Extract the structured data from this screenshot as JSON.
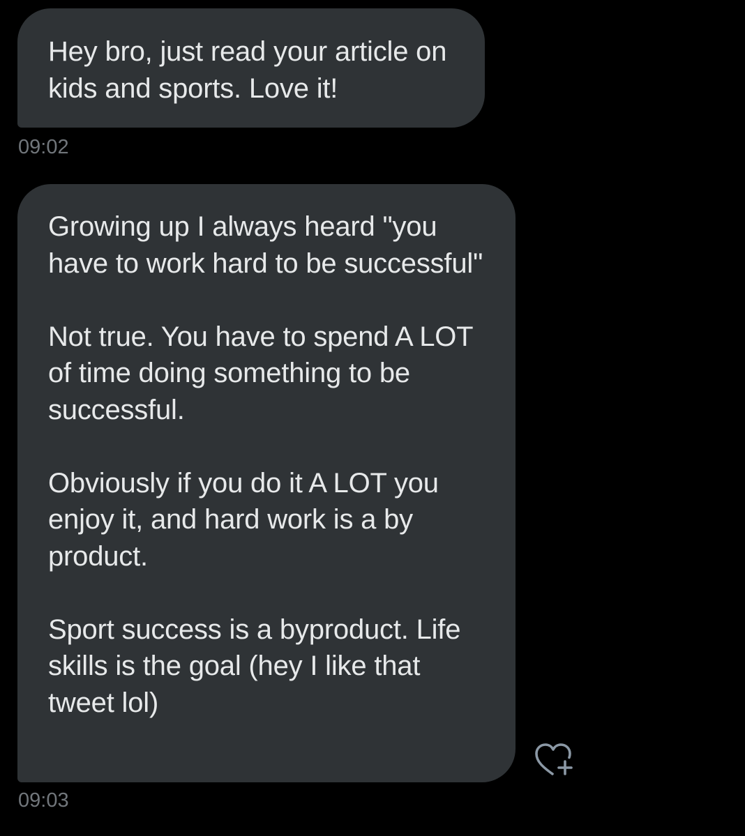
{
  "messages": [
    {
      "paragraphs": [
        "Hey bro, just read your article on kids and sports. Love it!"
      ],
      "time": "09:02"
    },
    {
      "paragraphs": [
        "Growing up I always heard \"you have to work hard to be successful\"",
        "Not true. You have to spend A LOT of time doing something to be successful.",
        "Obviously if you do it A LOT you enjoy it, and hard work is a by product.",
        "Sport success is a byproduct. Life skills is the goal (hey I like that tweet lol)"
      ],
      "time": "09:03"
    }
  ],
  "icons": {
    "add_reaction": "heart-plus-icon"
  },
  "colors": {
    "background": "#000000",
    "bubble": "#2f3336",
    "text": "#e7e9ea",
    "timestamp": "#71767b"
  }
}
